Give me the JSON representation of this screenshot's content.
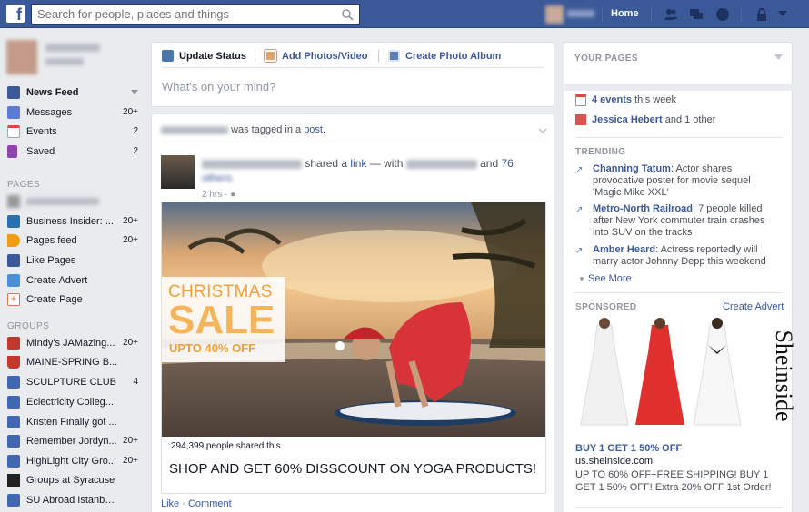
{
  "topbar": {
    "search_placeholder": "Search for people, places and things",
    "home": "Home",
    "user_name": "Jess"
  },
  "left": {
    "news_feed": "News Feed",
    "shortcuts": [
      {
        "label": "Messages",
        "count": "20+"
      },
      {
        "label": "Events",
        "count": "2"
      },
      {
        "label": "Saved",
        "count": "2"
      }
    ],
    "pages_header": "PAGES",
    "pages": [
      {
        "label": "Business Insider: ...",
        "count": "20+"
      },
      {
        "label": "Pages feed",
        "count": "20+"
      },
      {
        "label": "Like Pages",
        "count": ""
      },
      {
        "label": "Create Advert",
        "count": ""
      },
      {
        "label": "Create Page",
        "count": ""
      }
    ],
    "groups_header": "GROUPS",
    "groups": [
      {
        "label": "Mindy's JAMazing...",
        "count": "20+"
      },
      {
        "label": "MAINE-SPRING B...",
        "count": ""
      },
      {
        "label": "SCULPTURE CLUB",
        "count": "4"
      },
      {
        "label": "Eclectricity Colleg...",
        "count": ""
      },
      {
        "label": "Kristen Finally got ...",
        "count": ""
      },
      {
        "label": "Remember Jordyn...",
        "count": "20+"
      },
      {
        "label": "HighLight City Gro...",
        "count": "20+"
      },
      {
        "label": "Groups at Syracuse",
        "count": ""
      },
      {
        "label": "SU Abroad Istanbu...",
        "count": ""
      }
    ]
  },
  "composer": {
    "update_status": "Update Status",
    "add_photos": "Add Photos/Video",
    "create_album": "Create Photo Album",
    "placeholder": "What's on your mind?"
  },
  "post": {
    "tagged_text": "was tagged in a",
    "tagged_link": "post.",
    "shared_text": "shared a",
    "shared_link": "link",
    "with_text": "— with",
    "and_text": "and",
    "others_count": "76",
    "others_word": "others",
    "time": "2 hrs ·",
    "banner_line1": "CHRISTMAS",
    "banner_line2": "SALE",
    "banner_line3": "UPTO 40% OFF",
    "share_count": "294,399 people shared this",
    "link_title": "SHOP AND GET 60% DISSCOUNT ON YOGA PRODUCTS!",
    "like": "Like",
    "sep": " · ",
    "comment": "Comment"
  },
  "right": {
    "your_pages": "YOUR PAGES",
    "events_link": "4 events",
    "events_rest": " this week",
    "birthday_link": "Jessica Hebert",
    "birthday_rest": " and 1 other",
    "trending_header": "TRENDING",
    "trending": [
      {
        "title": "Channing Tatum",
        "text": ": Actor shares provocative poster for movie sequel 'Magic Mike XXL'"
      },
      {
        "title": "Metro-North Railroad",
        "text": ": 7 people killed after New York commuter train crashes into SUV on the tracks"
      },
      {
        "title": "Amber Heard",
        "text": ": Actress reportedly will marry actor Johnny Depp this weekend"
      }
    ],
    "see_more": "See More",
    "sponsored": "SPONSORED",
    "create_advert": "Create Advert",
    "ad_brand": "Sheinside",
    "ad_title": "BUY 1 GET 1 50% OFF",
    "ad_url": "us.sheinside.com",
    "ad_text": "UP TO 60% OFF+FREE SHIPPING! BUY 1 GET 1 50% OFF! Extra 20% OFF 1st Order!"
  },
  "colors": {
    "brand": "#3b5998",
    "background": "#e9ebee",
    "link": "#3b5998"
  }
}
